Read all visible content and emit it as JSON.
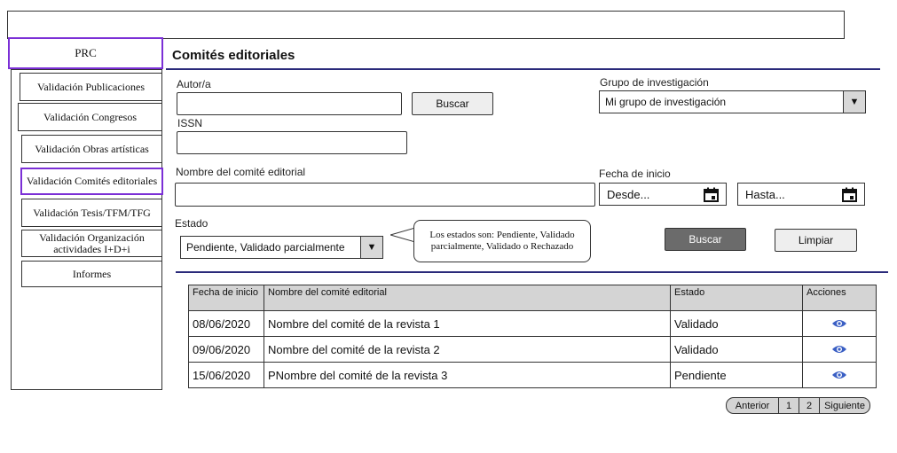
{
  "sidebar": {
    "root_label": "PRC",
    "items": [
      {
        "label": "Validación Publicaciones"
      },
      {
        "label": "Validación Congresos"
      },
      {
        "label": "Validación Obras artísticas"
      },
      {
        "label": "Validación Comités editoriales"
      },
      {
        "label": "Validación Tesis/TFM/TFG"
      },
      {
        "label": "Validación Organización actividades I+D+i"
      },
      {
        "label": "Informes"
      }
    ],
    "active_index": 3
  },
  "page": {
    "title": "Comités editoriales"
  },
  "form": {
    "autor_label": "Autor/a",
    "autor_value": "",
    "buscar_autor_label": "Buscar",
    "issn_label": "ISSN",
    "issn_value": "",
    "grupo_label": "Grupo de investigación",
    "grupo_value": "Mi grupo de investigación",
    "nombre_label": "Nombre del comité editorial",
    "nombre_value": "",
    "fecha_label": "Fecha de inicio",
    "desde_placeholder": "Desde...",
    "hasta_placeholder": "Hasta...",
    "estado_label": "Estado",
    "estado_value": "Pendiente, Validado parcialmente",
    "tooltip": "Los estados son: Pendiente, Validado parcialmente, Validado o Rechazado",
    "buscar_label": "Buscar",
    "limpiar_label": "Limpiar"
  },
  "table": {
    "headers": [
      "Fecha de inicio",
      "Nombre del comité editorial",
      "Estado",
      "Acciones"
    ],
    "rows": [
      {
        "fecha": "08/06/2020",
        "nombre": "Nombre del comité de la revista 1",
        "estado": "Validado"
      },
      {
        "fecha": "09/06/2020",
        "nombre": "Nombre del comité de la revista 2",
        "estado": "Validado"
      },
      {
        "fecha": "15/06/2020",
        "nombre": "PNombre del comité de la revista 3",
        "estado": "Pendiente"
      }
    ],
    "action_icon": "eye-icon"
  },
  "pagination": {
    "prev": "Anterior",
    "pages": [
      "1",
      "2"
    ],
    "next": "Siguiente"
  },
  "colors": {
    "accent_active": "#7b2fd6",
    "rule": "#2a2a7a",
    "eye": "#3a5fc4",
    "dark_button": "#6b6b6b"
  }
}
